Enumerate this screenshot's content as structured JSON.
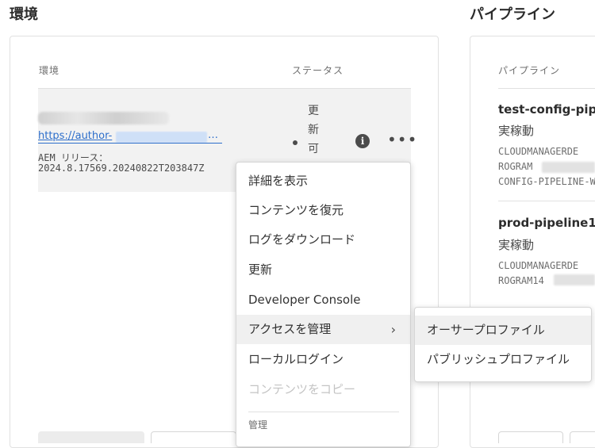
{
  "environments": {
    "section_title": "環境",
    "column_env": "環境",
    "column_status": "ステータス",
    "row": {
      "url": "https://author-",
      "url_ellipsis": "…",
      "release_label": "AEM リリース：",
      "release_version": "2024.8.17569.20240822T203847Z",
      "status_lines": [
        "更",
        "新",
        "可"
      ]
    }
  },
  "context_menu": {
    "items": [
      {
        "label": "詳細を表示",
        "disabled": false
      },
      {
        "label": "コンテンツを復元",
        "disabled": false
      },
      {
        "label": "ログをダウンロード",
        "disabled": false
      },
      {
        "label": "更新",
        "disabled": false
      },
      {
        "label": "Developer Console",
        "disabled": false
      },
      {
        "label": "アクセスを管理",
        "disabled": false,
        "has_submenu": true
      },
      {
        "label": "ローカルログイン",
        "disabled": false
      },
      {
        "label": "コンテンツをコピー",
        "disabled": true
      }
    ],
    "section_label": "管理",
    "submenu_icon": "chevron-right-icon"
  },
  "submenu": {
    "items": [
      "オーサープロファイル",
      "パブリッシュプロファイル"
    ]
  },
  "pipelines": {
    "section_title": "パイプライン",
    "column_pipeline": "パイプライン",
    "items": [
      {
        "name": "test-config-pipe",
        "status": "実稼動",
        "meta": [
          "CLOUDMANAGERDE",
          "ROGRAM",
          "CONFIG-PIPELINE-W"
        ]
      },
      {
        "name": "prod-pipeline1",
        "status": "実稼動",
        "meta": [
          "CLOUDMANAGERDE",
          "ROGRAM14"
        ]
      }
    ]
  },
  "icons": {
    "info": "info-icon",
    "more": "more-icon"
  }
}
